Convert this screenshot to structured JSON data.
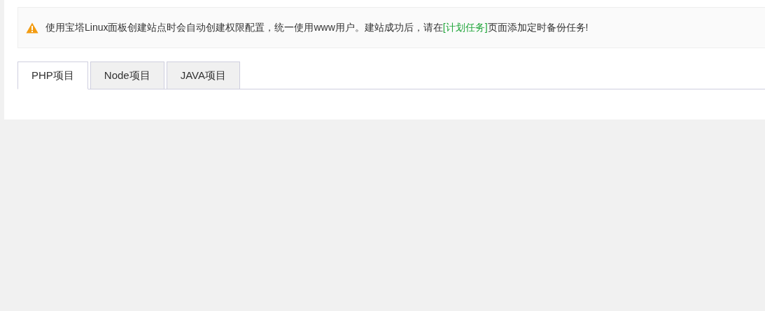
{
  "notice": {
    "text_before": "使用宝塔Linux面板创建站点时会自动创建权限配置，统一使用www用户。建站成功后，请在",
    "link": "[计划任务]",
    "text_after": "页面添加定时备份任务!"
  },
  "tabs": [
    {
      "label": "PHP项目",
      "selected": true
    },
    {
      "label": "Node项目",
      "selected": false
    },
    {
      "label": "JAVA项目",
      "selected": false
    }
  ]
}
